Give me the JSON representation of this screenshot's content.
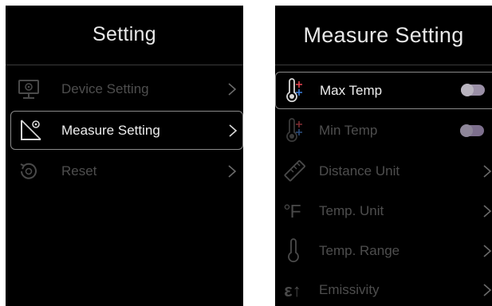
{
  "left_panel": {
    "title": "Setting",
    "items": [
      {
        "label": "Device Setting",
        "icon": "monitor-gear-icon",
        "selected": false
      },
      {
        "label": "Measure Setting",
        "icon": "measure-gear-icon",
        "selected": true
      },
      {
        "label": "Reset",
        "icon": "reset-icon",
        "selected": false
      }
    ]
  },
  "right_panel": {
    "title": "Measure Setting",
    "items": [
      {
        "label": "Max Temp",
        "icon": "thermometer-max-icon",
        "control": "toggle",
        "selected": true
      },
      {
        "label": "Min Temp",
        "icon": "thermometer-min-icon",
        "control": "toggle",
        "selected": false
      },
      {
        "label": "Distance Unit",
        "icon": "ruler-icon",
        "control": "chevron",
        "selected": false
      },
      {
        "label": "Temp. Unit",
        "icon": "fahrenheit-icon",
        "icon_text": "°F",
        "control": "chevron",
        "selected": false
      },
      {
        "label": "Temp. Range",
        "icon": "thermometer-icon",
        "control": "chevron",
        "selected": false
      },
      {
        "label": "Emissivity",
        "icon": "emissivity-icon",
        "icon_text": "ε↑",
        "control": "chevron",
        "selected": false
      }
    ]
  },
  "colors": {
    "background": "#000000",
    "text_active": "#ededed",
    "text_dim": "#4e4e4e",
    "toggle": "#9a8fa6",
    "thermo_red": "#e0424d",
    "thermo_blue": "#3a7bd5"
  }
}
